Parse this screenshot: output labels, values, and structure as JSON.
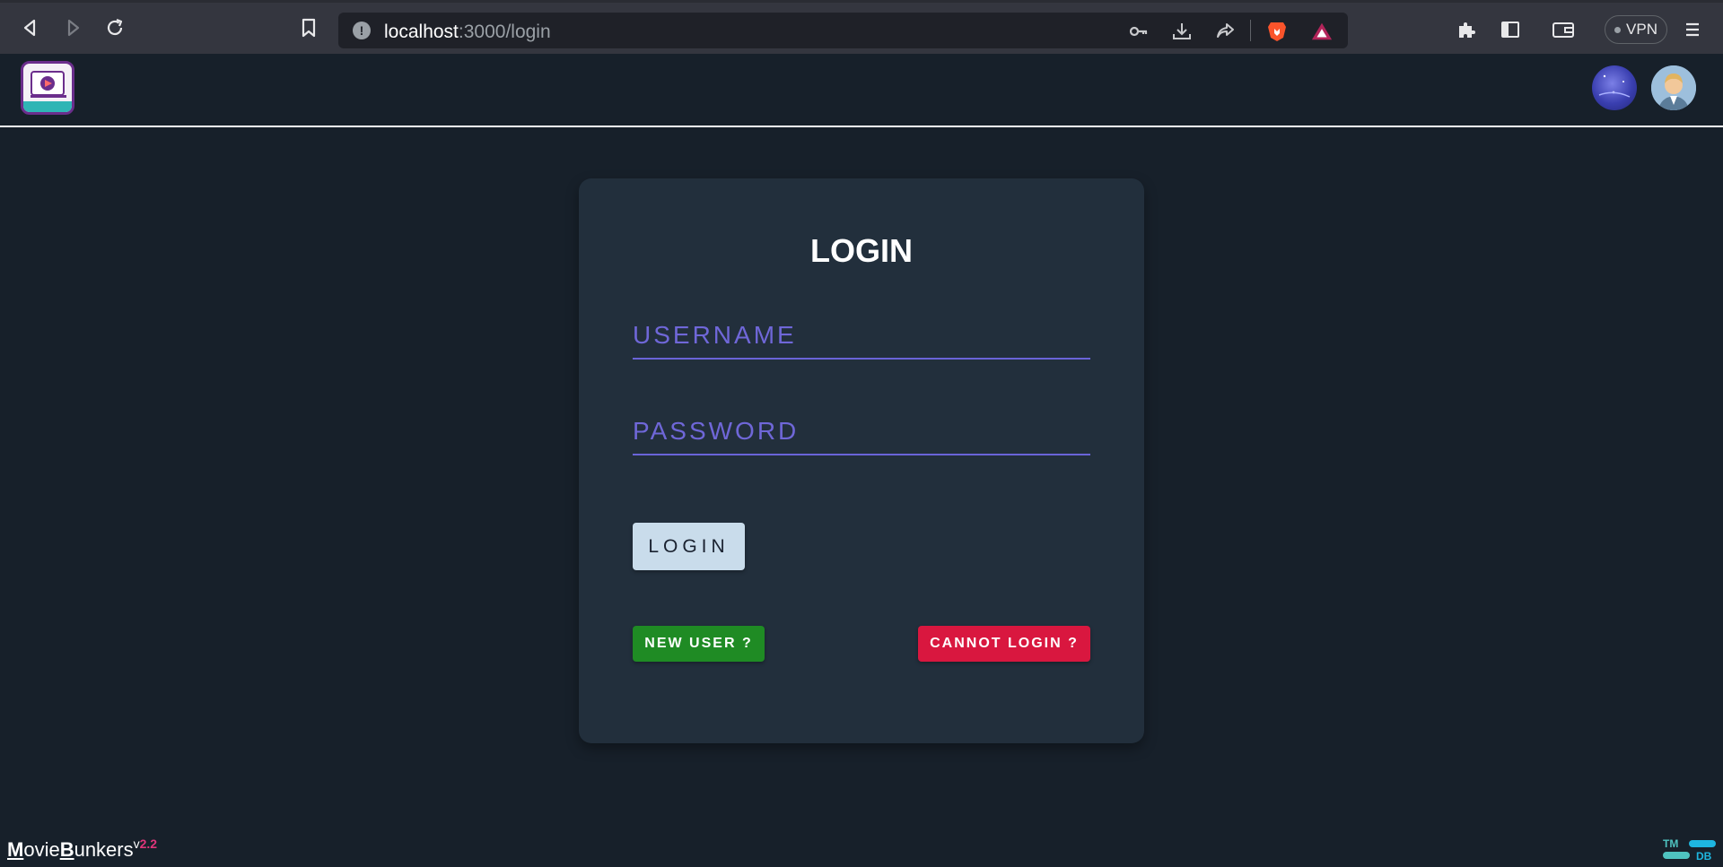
{
  "browser": {
    "url_host": "localhost",
    "url_path": ":3000/login",
    "vpn_label": "VPN"
  },
  "login": {
    "title": "LOGIN",
    "username_placeholder": "USERNAME",
    "password_placeholder": "PASSWORD",
    "login_button": "LOGIN",
    "new_user_button": "NEW USER ?",
    "cannot_login_button": "CANNOT LOGIN ?"
  },
  "footer": {
    "brand_m": "M",
    "brand_ovie": "ovie",
    "brand_b": "B",
    "brand_unkers": "unkers",
    "version_prefix": "v",
    "version_number": "2.2",
    "tmdb_top": "TM",
    "tmdb_bottom": "DB"
  },
  "colors": {
    "background": "#17202a",
    "card": "#222f3c",
    "accent": "#6f67d8",
    "new_user": "#1f8b24",
    "cannot_login": "#d9173f",
    "login_button": "#c9dceb"
  },
  "icons": [
    "back-icon",
    "forward-icon",
    "reload-icon",
    "bookmark-icon",
    "info-icon",
    "key-icon",
    "download-icon",
    "share-icon",
    "brave-icon",
    "rewards-icon",
    "extensions-icon",
    "sidebar-icon",
    "wallet-icon",
    "menu-icon"
  ]
}
